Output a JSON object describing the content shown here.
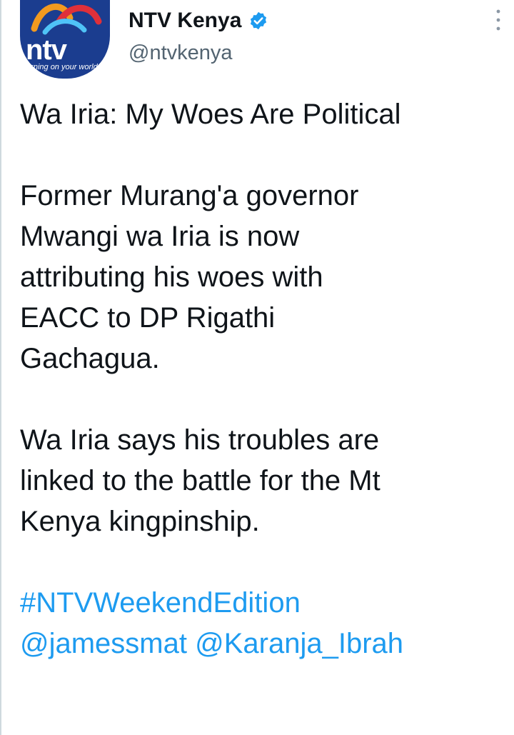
{
  "author": {
    "display_name": "NTV Kenya",
    "handle": "@ntvkenya",
    "avatar": {
      "logo_text": "ntv",
      "tagline": "turning on your world",
      "colors": {
        "background": "#1b3d8f",
        "swoosh_orange": "#f29a1f",
        "swoosh_red": "#e0303a",
        "swoosh_cyan": "#4fc3f7"
      }
    },
    "verified": true
  },
  "icons": {
    "verified": "verified-badge-icon",
    "more": "more-options-icon"
  },
  "tweet": {
    "headline": "Wa Iria: My Woes Are Political",
    "paragraph1": [
      "Former Murang'a governor",
      "Mwangi wa Iria is now",
      "attributing his woes with",
      "EACC to DP Rigathi",
      "Gachagua."
    ],
    "paragraph2": [
      "Wa Iria says his troubles are",
      "linked to the battle for the Mt",
      "Kenya kingpinship."
    ],
    "hashtag": "#NTVWeekendEdition",
    "mentions": [
      "@jamessmat",
      "@Karanja_Ibrah"
    ]
  },
  "colors": {
    "link": "#1d9bf0",
    "text": "#0f1419",
    "secondary": "#536471"
  }
}
